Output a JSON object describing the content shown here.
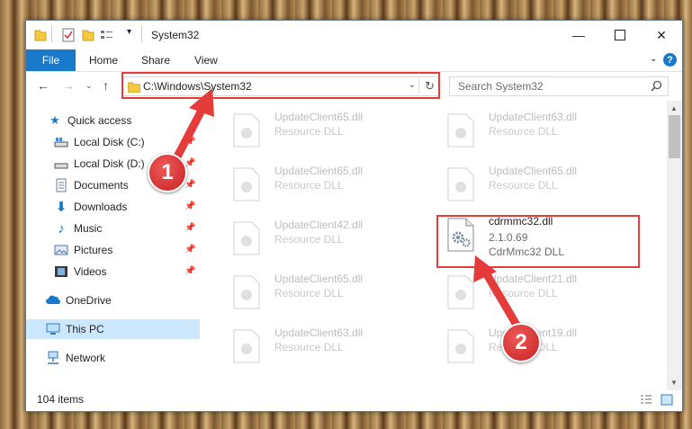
{
  "window": {
    "title": "System32",
    "tabs": [
      "File",
      "Home",
      "Share",
      "View"
    ],
    "help_icon": "?"
  },
  "address": {
    "path": "C:\\Windows\\System32",
    "search_placeholder": "Search System32"
  },
  "navigation": {
    "items": [
      {
        "label": "Quick access",
        "icon": "star-icon"
      },
      {
        "label": "Local Disk (C:)",
        "icon": "drive-icon",
        "pinned": true
      },
      {
        "label": "Local Disk (D:)",
        "icon": "drive-icon",
        "pinned": true
      },
      {
        "label": "Documents",
        "icon": "documents-icon",
        "pinned": true
      },
      {
        "label": "Downloads",
        "icon": "download-icon",
        "pinned": true
      },
      {
        "label": "Music",
        "icon": "music-icon",
        "pinned": true
      },
      {
        "label": "Pictures",
        "icon": "pictures-icon",
        "pinned": true
      },
      {
        "label": "Videos",
        "icon": "videos-icon",
        "pinned": true
      },
      {
        "label": "OneDrive",
        "icon": "cloud-icon"
      },
      {
        "label": "This PC",
        "icon": "computer-icon",
        "selected": true
      },
      {
        "label": "Network",
        "icon": "network-icon"
      }
    ]
  },
  "files": [
    {
      "name": "UpdateClient65.dll",
      "sub": "Resource DLL",
      "blurred": true
    },
    {
      "name": "UpdateClient63.dll",
      "sub": "Resource DLL",
      "blurred": true
    },
    {
      "name": "UpdateClient65.dll",
      "sub": "Resource DLL",
      "blurred": true
    },
    {
      "name": "UpdateClient65.dll",
      "sub": "Resource DLL",
      "blurred": true
    },
    {
      "name": "UpdateClient42.dll",
      "sub": "Resource DLL",
      "blurred": true
    },
    {
      "name": "cdrmmc32.dll",
      "version": "2.1.0.69",
      "sub": "CdrMmc32 DLL",
      "blurred": false
    },
    {
      "name": "UpdateClient65.dll",
      "sub": "Resource DLL",
      "blurred": true
    },
    {
      "name": "UpdateClient21.dll",
      "sub": "Resource DLL",
      "blurred": true
    },
    {
      "name": "UpdateClient63.dll",
      "sub": "Resource DLL",
      "blurred": true
    },
    {
      "name": "UpdateClient19.dll",
      "sub": "Resource DLL",
      "blurred": true
    }
  ],
  "status": {
    "item_count": "104 items"
  },
  "annotations": {
    "step1": "1",
    "step2": "2",
    "color": "#e53b3b"
  },
  "colors": {
    "accent": "#1979ca",
    "selection": "#cce8ff"
  }
}
